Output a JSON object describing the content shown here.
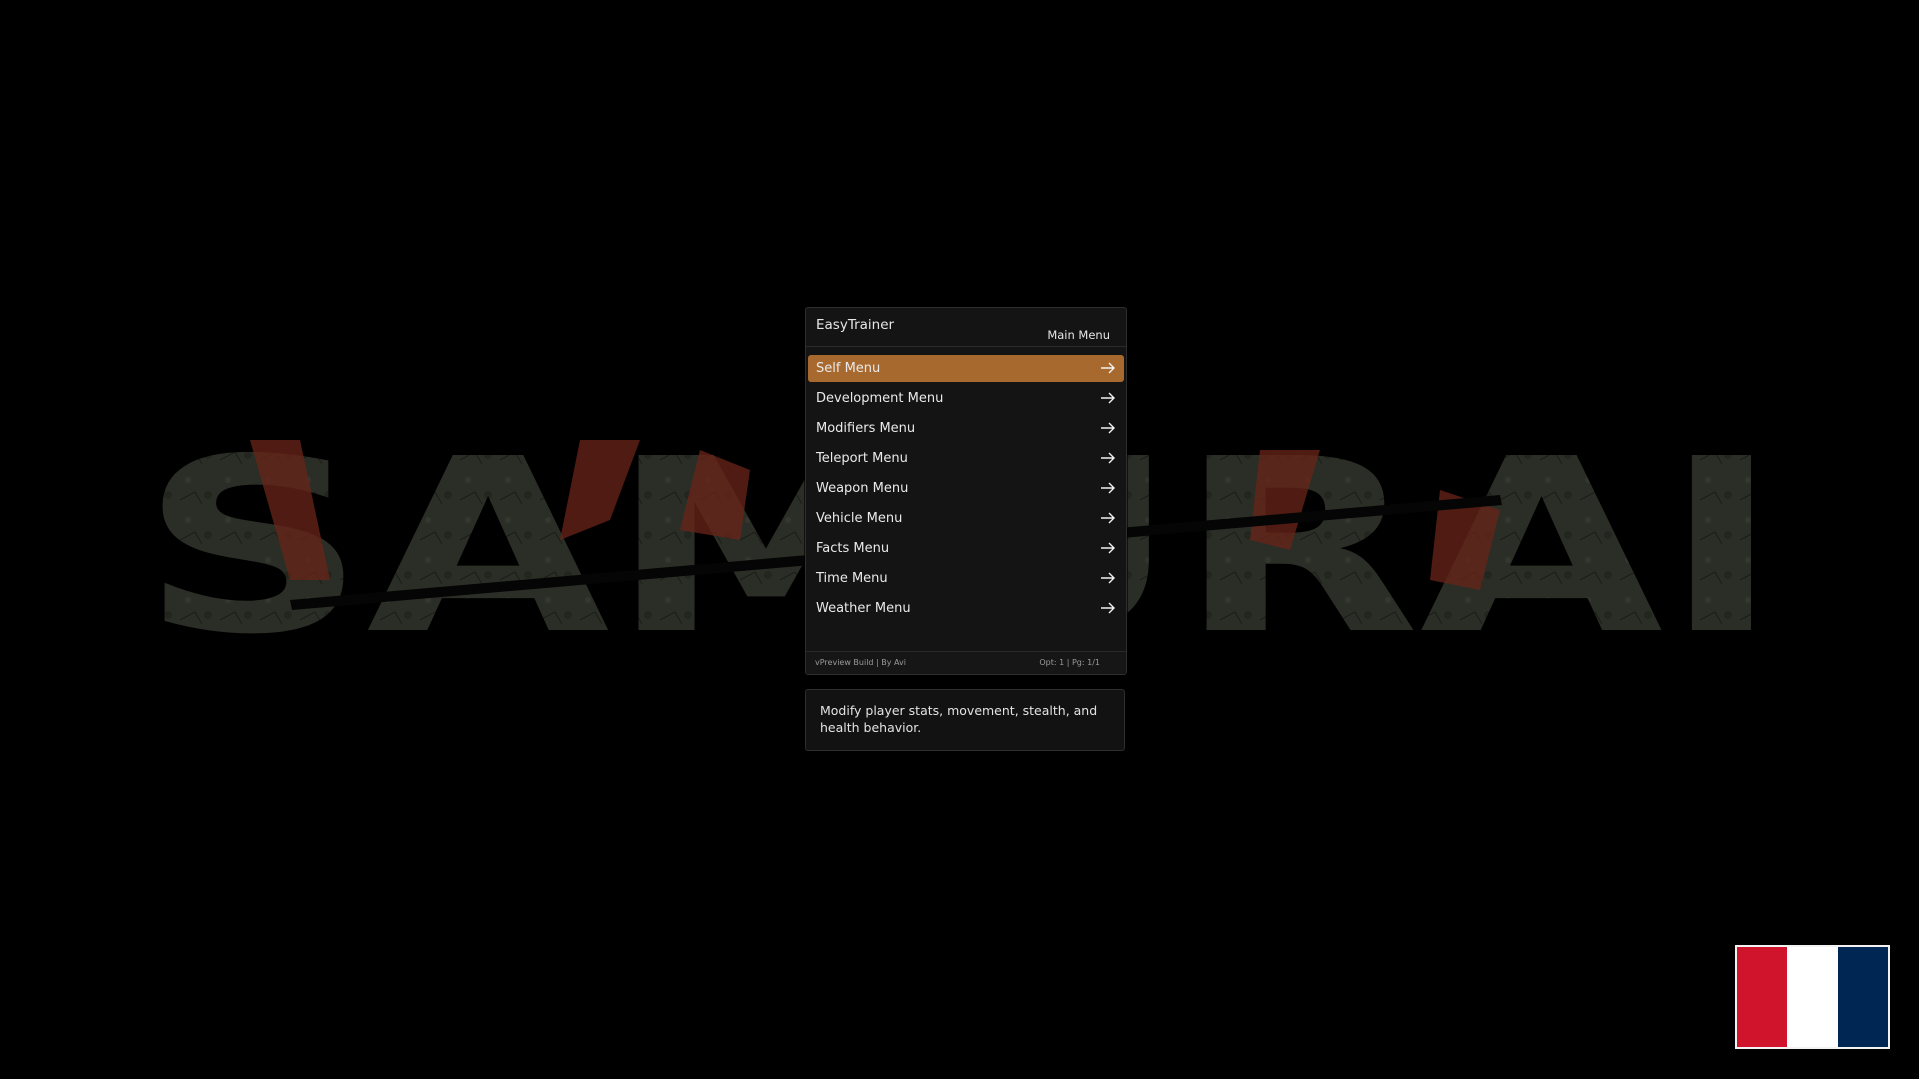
{
  "background": {
    "banner_text": "SAMURAI"
  },
  "menu": {
    "title": "EasyTrainer",
    "subtitle": "Main Menu",
    "items": [
      {
        "label": "Self Menu",
        "selected": true
      },
      {
        "label": "Development Menu",
        "selected": false
      },
      {
        "label": "Modifiers Menu",
        "selected": false
      },
      {
        "label": "Teleport Menu",
        "selected": false
      },
      {
        "label": "Weapon Menu",
        "selected": false
      },
      {
        "label": "Vehicle Menu",
        "selected": false
      },
      {
        "label": "Facts Menu",
        "selected": false
      },
      {
        "label": "Time Menu",
        "selected": false
      },
      {
        "label": "Weather Menu",
        "selected": false
      }
    ],
    "arrow_icon": "arrow-right-icon",
    "footer_left": "vPreview Build | By Avi",
    "footer_right": "Opt: 1 | Pg: 1/1",
    "highlight_color": "#a8692f"
  },
  "description": {
    "text": "Modify player stats, movement, stealth, and health behavior."
  },
  "language_flag": {
    "icon": "french-flag-icon",
    "colors": [
      "#cf142b",
      "#ffffff",
      "#002654"
    ]
  }
}
